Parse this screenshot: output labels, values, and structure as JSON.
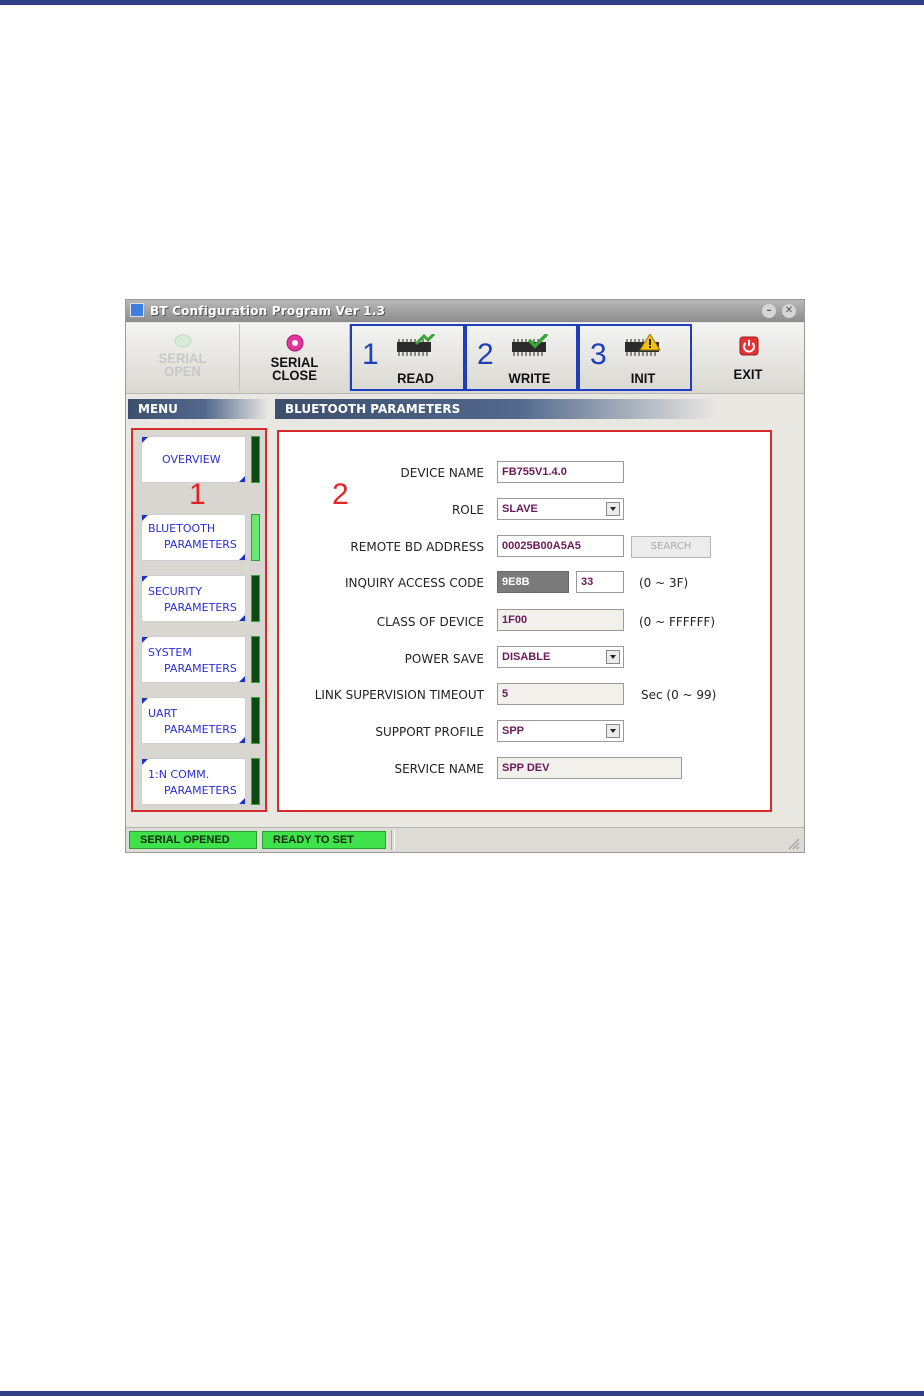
{
  "window": {
    "title": "BT Configuration Program Ver 1.3"
  },
  "toolbar": {
    "serial_open": "SERIAL\nOPEN",
    "serial_close_1": "SERIAL",
    "serial_close_2": "CLOSE",
    "serial_open_1": "SERIAL",
    "serial_open_2": "OPEN",
    "read": {
      "num": "1",
      "label": "READ"
    },
    "write": {
      "num": "2",
      "label": "WRITE"
    },
    "init": {
      "num": "3",
      "label": "INIT"
    },
    "exit": "EXIT"
  },
  "menu": {
    "header": "MENU",
    "annotation": "1",
    "items": [
      {
        "line1": "OVERVIEW",
        "line2": "",
        "active": false
      },
      {
        "line1": "BLUETOOTH",
        "line2": "PARAMETERS",
        "active": true
      },
      {
        "line1": "SECURITY",
        "line2": "PARAMETERS",
        "active": false
      },
      {
        "line1": "SYSTEM",
        "line2": "PARAMETERS",
        "active": false
      },
      {
        "line1": "UART",
        "line2": "PARAMETERS",
        "active": false
      },
      {
        "line1": "1:N COMM.",
        "line2": "PARAMETERS",
        "active": false
      }
    ]
  },
  "panel": {
    "header": "BLUETOOTH PARAMETERS",
    "annotation": "2",
    "device_name": {
      "label": "DEVICE NAME",
      "value": "FB755V1.4.0"
    },
    "role": {
      "label": "ROLE",
      "value": "SLAVE"
    },
    "remote_bd": {
      "label": "REMOTE BD ADDRESS",
      "value": "00025B00A5A5",
      "button": "SEARCH"
    },
    "inquiry": {
      "label": "INQUIRY ACCESS CODE",
      "value1": "9E8B",
      "value2": "33",
      "hint": "(0 ~ 3F)"
    },
    "class_of_device": {
      "label": "CLASS OF DEVICE",
      "value": "1F00",
      "hint": "(0 ~ FFFFFF)"
    },
    "power_save": {
      "label": "POWER SAVE",
      "value": "DISABLE"
    },
    "link_timeout": {
      "label": "LINK SUPERVISION TIMEOUT",
      "value": "5",
      "hint": "Sec (0 ~ 99)"
    },
    "support_profile": {
      "label": "SUPPORT PROFILE",
      "value": "SPP"
    },
    "service_name": {
      "label": "SERVICE NAME",
      "value": "SPP DEV"
    }
  },
  "status": {
    "serial": "SERIAL OPENED",
    "ready": "READY TO SET"
  }
}
